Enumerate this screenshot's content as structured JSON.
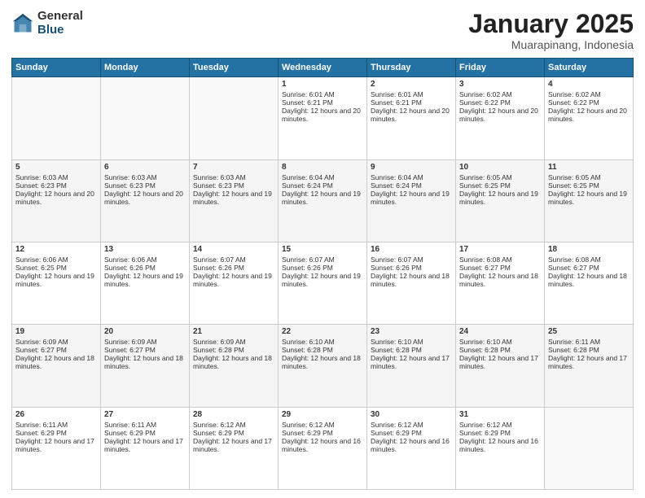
{
  "header": {
    "logo_general": "General",
    "logo_blue": "Blue",
    "title": "January 2025",
    "location": "Muarapinang, Indonesia"
  },
  "weekdays": [
    "Sunday",
    "Monday",
    "Tuesday",
    "Wednesday",
    "Thursday",
    "Friday",
    "Saturday"
  ],
  "weeks": [
    [
      {
        "day": "",
        "info": ""
      },
      {
        "day": "",
        "info": ""
      },
      {
        "day": "",
        "info": ""
      },
      {
        "day": "1",
        "info": "Sunrise: 6:01 AM\nSunset: 6:21 PM\nDaylight: 12 hours and 20 minutes."
      },
      {
        "day": "2",
        "info": "Sunrise: 6:01 AM\nSunset: 6:21 PM\nDaylight: 12 hours and 20 minutes."
      },
      {
        "day": "3",
        "info": "Sunrise: 6:02 AM\nSunset: 6:22 PM\nDaylight: 12 hours and 20 minutes."
      },
      {
        "day": "4",
        "info": "Sunrise: 6:02 AM\nSunset: 6:22 PM\nDaylight: 12 hours and 20 minutes."
      }
    ],
    [
      {
        "day": "5",
        "info": "Sunrise: 6:03 AM\nSunset: 6:23 PM\nDaylight: 12 hours and 20 minutes."
      },
      {
        "day": "6",
        "info": "Sunrise: 6:03 AM\nSunset: 6:23 PM\nDaylight: 12 hours and 20 minutes."
      },
      {
        "day": "7",
        "info": "Sunrise: 6:03 AM\nSunset: 6:23 PM\nDaylight: 12 hours and 19 minutes."
      },
      {
        "day": "8",
        "info": "Sunrise: 6:04 AM\nSunset: 6:24 PM\nDaylight: 12 hours and 19 minutes."
      },
      {
        "day": "9",
        "info": "Sunrise: 6:04 AM\nSunset: 6:24 PM\nDaylight: 12 hours and 19 minutes."
      },
      {
        "day": "10",
        "info": "Sunrise: 6:05 AM\nSunset: 6:25 PM\nDaylight: 12 hours and 19 minutes."
      },
      {
        "day": "11",
        "info": "Sunrise: 6:05 AM\nSunset: 6:25 PM\nDaylight: 12 hours and 19 minutes."
      }
    ],
    [
      {
        "day": "12",
        "info": "Sunrise: 6:06 AM\nSunset: 6:25 PM\nDaylight: 12 hours and 19 minutes."
      },
      {
        "day": "13",
        "info": "Sunrise: 6:06 AM\nSunset: 6:26 PM\nDaylight: 12 hours and 19 minutes."
      },
      {
        "day": "14",
        "info": "Sunrise: 6:07 AM\nSunset: 6:26 PM\nDaylight: 12 hours and 19 minutes."
      },
      {
        "day": "15",
        "info": "Sunrise: 6:07 AM\nSunset: 6:26 PM\nDaylight: 12 hours and 19 minutes."
      },
      {
        "day": "16",
        "info": "Sunrise: 6:07 AM\nSunset: 6:26 PM\nDaylight: 12 hours and 18 minutes."
      },
      {
        "day": "17",
        "info": "Sunrise: 6:08 AM\nSunset: 6:27 PM\nDaylight: 12 hours and 18 minutes."
      },
      {
        "day": "18",
        "info": "Sunrise: 6:08 AM\nSunset: 6:27 PM\nDaylight: 12 hours and 18 minutes."
      }
    ],
    [
      {
        "day": "19",
        "info": "Sunrise: 6:09 AM\nSunset: 6:27 PM\nDaylight: 12 hours and 18 minutes."
      },
      {
        "day": "20",
        "info": "Sunrise: 6:09 AM\nSunset: 6:27 PM\nDaylight: 12 hours and 18 minutes."
      },
      {
        "day": "21",
        "info": "Sunrise: 6:09 AM\nSunset: 6:28 PM\nDaylight: 12 hours and 18 minutes."
      },
      {
        "day": "22",
        "info": "Sunrise: 6:10 AM\nSunset: 6:28 PM\nDaylight: 12 hours and 18 minutes."
      },
      {
        "day": "23",
        "info": "Sunrise: 6:10 AM\nSunset: 6:28 PM\nDaylight: 12 hours and 17 minutes."
      },
      {
        "day": "24",
        "info": "Sunrise: 6:10 AM\nSunset: 6:28 PM\nDaylight: 12 hours and 17 minutes."
      },
      {
        "day": "25",
        "info": "Sunrise: 6:11 AM\nSunset: 6:28 PM\nDaylight: 12 hours and 17 minutes."
      }
    ],
    [
      {
        "day": "26",
        "info": "Sunrise: 6:11 AM\nSunset: 6:29 PM\nDaylight: 12 hours and 17 minutes."
      },
      {
        "day": "27",
        "info": "Sunrise: 6:11 AM\nSunset: 6:29 PM\nDaylight: 12 hours and 17 minutes."
      },
      {
        "day": "28",
        "info": "Sunrise: 6:12 AM\nSunset: 6:29 PM\nDaylight: 12 hours and 17 minutes."
      },
      {
        "day": "29",
        "info": "Sunrise: 6:12 AM\nSunset: 6:29 PM\nDaylight: 12 hours and 16 minutes."
      },
      {
        "day": "30",
        "info": "Sunrise: 6:12 AM\nSunset: 6:29 PM\nDaylight: 12 hours and 16 minutes."
      },
      {
        "day": "31",
        "info": "Sunrise: 6:12 AM\nSunset: 6:29 PM\nDaylight: 12 hours and 16 minutes."
      },
      {
        "day": "",
        "info": ""
      }
    ]
  ]
}
